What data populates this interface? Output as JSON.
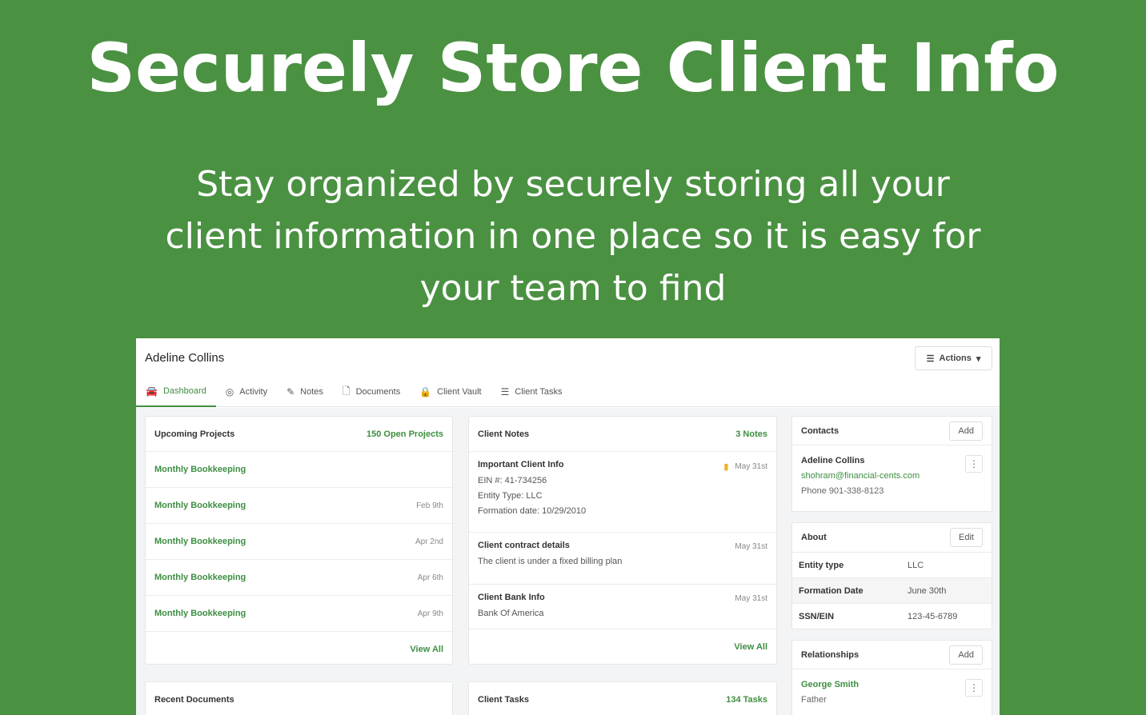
{
  "hero": {
    "title": "Securely Store Client Info",
    "subtitle_line1": "Stay organized by securely storing all your",
    "subtitle_line2": "client information in one place so it is easy for",
    "subtitle_line3": "your team to find"
  },
  "colors": {
    "background": "#4a9142",
    "accent": "#3e8e41",
    "bookmark": "#f2b01e"
  },
  "client": {
    "name": "Adeline Collins",
    "actions_label": "Actions"
  },
  "tabs": [
    {
      "label": "Dashboard",
      "icon": "car-icon"
    },
    {
      "label": "Activity",
      "icon": "activity-icon"
    },
    {
      "label": "Notes",
      "icon": "notes-icon"
    },
    {
      "label": "Documents",
      "icon": "document-icon"
    },
    {
      "label": "Client Vault",
      "icon": "lock-icon"
    },
    {
      "label": "Client Tasks",
      "icon": "tasks-icon"
    }
  ],
  "projects": {
    "title": "Upcoming Projects",
    "count_label": "150 Open Projects",
    "items": [
      {
        "name": "Monthly Bookkeeping",
        "date": ""
      },
      {
        "name": "Monthly Bookkeeping",
        "date": "Feb 9th"
      },
      {
        "name": "Monthly Bookkeeping",
        "date": "Apr 2nd"
      },
      {
        "name": "Monthly Bookkeeping",
        "date": "Apr 6th"
      },
      {
        "name": "Monthly Bookkeeping",
        "date": "Apr 9th"
      }
    ],
    "view_all": "View All"
  },
  "recent_documents": {
    "title": "Recent Documents"
  },
  "notes": {
    "title": "Client Notes",
    "count_label": "3 Notes",
    "items": [
      {
        "title": "Important Client Info",
        "date": "May 31st",
        "lines": [
          "EIN #: 41-734256",
          "Entity Type: LLC",
          "Formation date: 10/29/2010"
        ]
      },
      {
        "title": "Client contract details",
        "date": "May 31st",
        "lines": [
          "The client is under a fixed billing plan"
        ]
      },
      {
        "title": "Client Bank Info",
        "date": "May 31st",
        "lines": [
          "Bank Of America"
        ]
      }
    ],
    "view_all": "View All"
  },
  "tasks": {
    "title": "Client Tasks",
    "count_label": "134 Tasks"
  },
  "contacts": {
    "title": "Contacts",
    "add_label": "Add",
    "name": "Adeline Collins",
    "email": "shohram@financial-cents.com",
    "phone": "Phone 901-338-8123"
  },
  "about": {
    "title": "About",
    "edit_label": "Edit",
    "rows": [
      {
        "key": "Entity type",
        "value": "LLC"
      },
      {
        "key": "Formation Date",
        "value": "June 30th"
      },
      {
        "key": "SSN/EIN",
        "value": "123-45-6789"
      }
    ]
  },
  "relationships": {
    "title": "Relationships",
    "add_label": "Add",
    "name": "George Smith",
    "role": "Father"
  }
}
